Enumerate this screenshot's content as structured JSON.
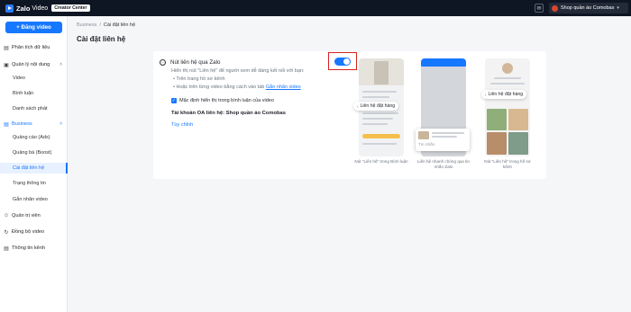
{
  "topbar": {
    "brand_name": "Zalo",
    "brand_sub": "Video",
    "creator_badge": "Creator Center",
    "account_name": "Shop quần áo Comobas",
    "account_chevron": "▾"
  },
  "sidebar": {
    "upload_label": "+ Đăng video",
    "items": [
      {
        "label": "Phân tích dữ liệu",
        "icon": "analytics-icon"
      },
      {
        "label": "Quản lý nội dung",
        "icon": "content-icon"
      },
      {
        "label": "Video"
      },
      {
        "label": "Bình luận"
      },
      {
        "label": "Danh sách phát"
      },
      {
        "label": "Business",
        "icon": "business-icon"
      },
      {
        "label": "Quảng cáo (Ads)"
      },
      {
        "label": "Quảng bá (Boost)"
      },
      {
        "label": "Cài đặt liên hệ"
      },
      {
        "label": "Trạng thông tin"
      },
      {
        "label": "Gắn nhãn video"
      },
      {
        "label": "Quản trị viên",
        "icon": "admin-icon"
      },
      {
        "label": "Đồng bộ video",
        "icon": "sync-icon"
      },
      {
        "label": "Thông tin kênh",
        "icon": "info-icon"
      }
    ]
  },
  "breadcrumb": {
    "parent": "Business",
    "separator": "/",
    "current": "Cài đặt liên hệ"
  },
  "page_title": "Cài đặt liên hệ",
  "setting": {
    "title": "Nút liên hệ qua Zalo",
    "toggle_on": true,
    "description": "Hiển thị nút \"Liên hệ\" để người xem dễ dàng kết nối với bạn:",
    "bullet1": "Trên trang hồ sơ kênh",
    "bullet2_prefix": "Hoặc trên từng video bằng cách vào tab ",
    "bullet2_link": "Gắn nhãn video",
    "checkbox_label": "Mặc định hiển thị trong bình luận của video",
    "oa_line": "Tài khoản OA liên hệ: Shop quần áo Comobas",
    "customize": "Tùy chỉnh"
  },
  "previews": [
    {
      "pill": "Liên hệ đặt hàng",
      "caption": "Nút \"Liên hệ\" trong Bình luận"
    },
    {
      "popup_text": "Tin nhắn",
      "caption": "Liên hệ nhanh chóng qua tin nhắn Zalo"
    },
    {
      "pill": "Liên hệ đặt hàng",
      "caption": "Nút \"Liên hệ\" trong hồ sơ kênh"
    }
  ],
  "colors": {
    "accent": "#1677ff",
    "topbar": "#0f1623",
    "highlight": "#d4231d"
  }
}
